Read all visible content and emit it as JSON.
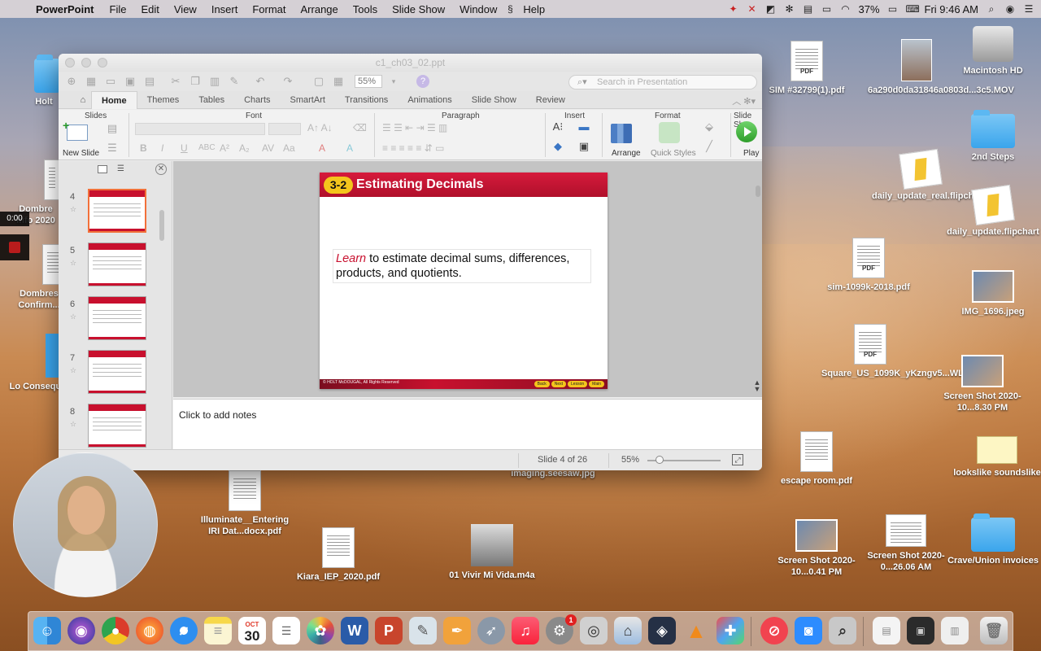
{
  "menubar": {
    "app_name": "PowerPoint",
    "menus": [
      "File",
      "Edit",
      "View",
      "Insert",
      "Format",
      "Arrange",
      "Tools",
      "Slide Show",
      "Window",
      "Help"
    ],
    "battery": "37%",
    "clock": "Fri 9:46 AM"
  },
  "window": {
    "title": "c1_ch03_02.ppt",
    "zoom": "55%",
    "search_placeholder": "Search in Presentation",
    "ribbon_tabs": [
      "Home",
      "Themes",
      "Tables",
      "Charts",
      "SmartArt",
      "Transitions",
      "Animations",
      "Slide Show",
      "Review"
    ],
    "groups": {
      "slides": "Slides",
      "font": "Font",
      "paragraph": "Paragraph",
      "insert": "Insert",
      "format": "Format",
      "slide_show": "Slide Sh"
    },
    "buttons": {
      "new_slide": "New Slide",
      "arrange": "Arrange",
      "quick_styles": "Quick Styles",
      "play": "Play"
    },
    "thumbnails": [
      {
        "num": "4",
        "selected": true
      },
      {
        "num": "5",
        "selected": false
      },
      {
        "num": "6",
        "selected": false
      },
      {
        "num": "7",
        "selected": false
      },
      {
        "num": "8",
        "selected": false
      }
    ],
    "slide": {
      "badge": "3-2",
      "title": "Estimating Decimals",
      "body_emphasis": "Learn",
      "body_rest": " to estimate decimal sums, differences, products, and quotients.",
      "copyright": "© HOLT McDOUGAL, All Rights Reserved",
      "nav_buttons": [
        "Back",
        "Next",
        "Lesson",
        "Main"
      ]
    },
    "notes_placeholder": "Click to add notes",
    "status": {
      "slide_count": "Slide 4 of 26",
      "zoom": "55%"
    }
  },
  "recording": {
    "timer": "0:00"
  },
  "desktop_icons": [
    {
      "label": "SIM #32799(1).pdf",
      "kind": "pdf"
    },
    {
      "label": "6a290d0da31846a0803d...3c5.MOV",
      "kind": "video"
    },
    {
      "label": "Macintosh HD",
      "kind": "disk"
    },
    {
      "label": "2nd Steps",
      "kind": "folder"
    },
    {
      "label": "daily_update_real.flipchart",
      "kind": "flipchart"
    },
    {
      "label": "daily_update.flipchart",
      "kind": "flipchart"
    },
    {
      "label": "sim-1099k-2018.pdf",
      "kind": "pdf"
    },
    {
      "label": "IMG_1696.jpeg",
      "kind": "image"
    },
    {
      "label": "Square_US_1099K_yKzngv5...WL.pdf",
      "kind": "pdf"
    },
    {
      "label": "Screen Shot 2020-10...8.30 PM",
      "kind": "image"
    },
    {
      "label": "escape room.pdf",
      "kind": "pdf"
    },
    {
      "label": "lookslike soundslike",
      "kind": "envelope"
    },
    {
      "label": "Screen Shot 2020-10...0.41 PM",
      "kind": "image"
    },
    {
      "label": "Screen Shot 2020-0...26.06 AM",
      "kind": "image"
    },
    {
      "label": "Crave/Union invoices",
      "kind": "folder"
    },
    {
      "label": "imaging.seesaw.jpg",
      "kind": "image"
    },
    {
      "label": "Illuminate__Entering IRI Dat...docx.pdf",
      "kind": "pdf"
    },
    {
      "label": "Kiara_IEP_2020.pdf",
      "kind": "pdf"
    },
    {
      "label": "01 Vivir Mi Vida.m4a",
      "kind": "audio"
    },
    {
      "label": "Dombres Confirm...",
      "kind": "doc"
    },
    {
      "label": "Lo Consequ...",
      "kind": "doc"
    },
    {
      "label": "Holt",
      "kind": "folder"
    },
    {
      "label": "Dombre Info 2020",
      "kind": "doc"
    }
  ],
  "dock": {
    "items": [
      "Finder",
      "Siri",
      "Chrome",
      "Firefox",
      "Safari",
      "Notes",
      "Calendar",
      "Reminders",
      "Photos",
      "Word",
      "PowerPoint",
      "Preview",
      "Pages",
      "Launchpad",
      "Music",
      "System Preferences",
      "Screenshot",
      "Image Capture",
      "Screencast",
      "VLC",
      "Puzzle",
      "News",
      "Zoom",
      "Magnifier",
      "Downloads",
      "Documents",
      "Trash"
    ],
    "calendar_month": "OCT",
    "calendar_day": "30",
    "sysprefs_badge": "1"
  }
}
